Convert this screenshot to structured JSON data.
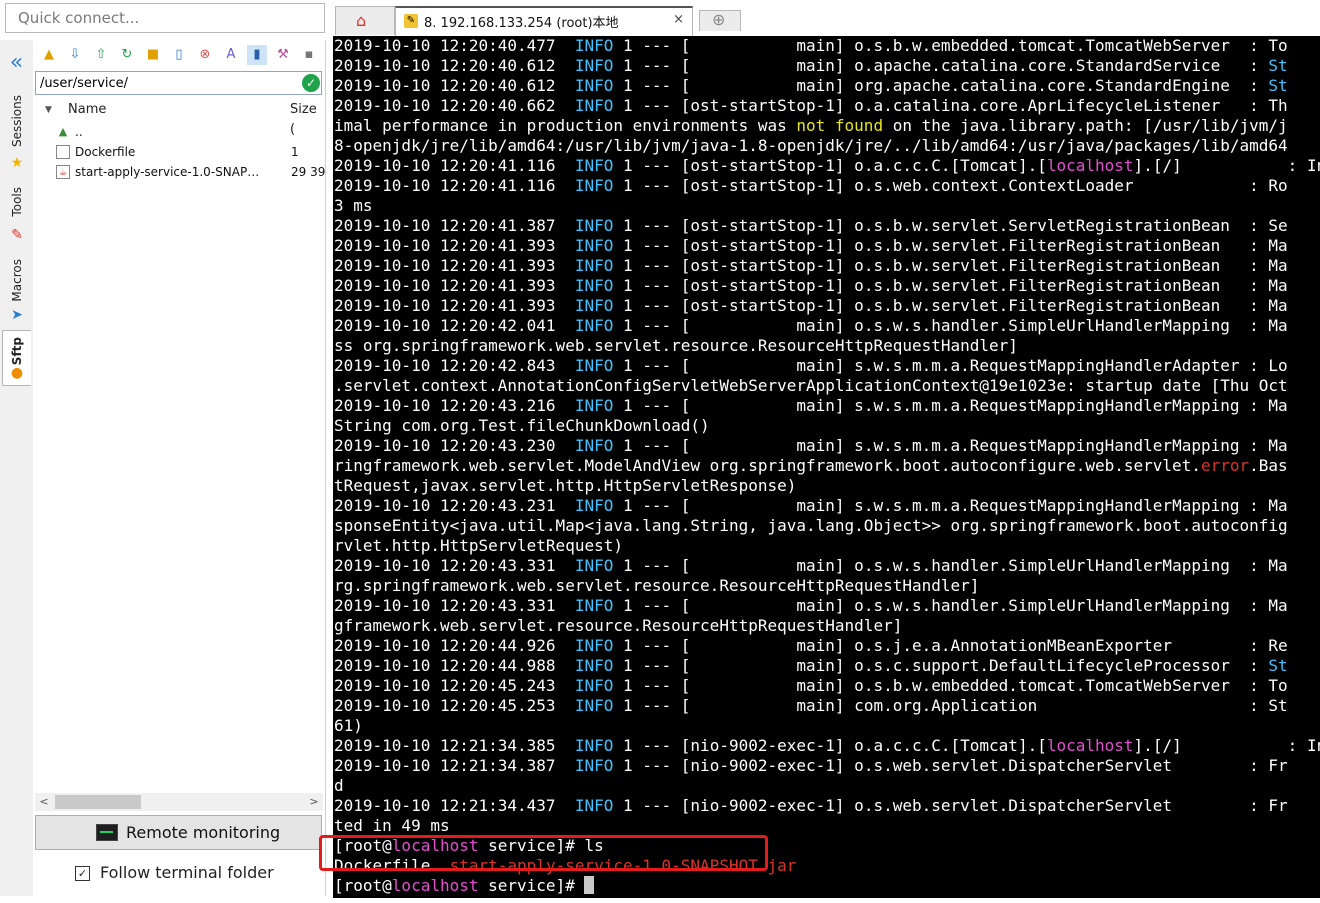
{
  "quick_connect": {
    "placeholder": "Quick connect..."
  },
  "side_tabs": [
    {
      "label": "Sessions",
      "icon": "star-icon"
    },
    {
      "label": "Tools",
      "icon": "tools-icon"
    },
    {
      "label": "Macros",
      "icon": "paper-plane-icon"
    },
    {
      "label": "Sftp",
      "icon": "sftp-icon"
    }
  ],
  "sftp": {
    "path": "/user/service/",
    "columns": {
      "name": "Name",
      "size": "Size ("
    },
    "files": [
      {
        "name": "..",
        "size": "",
        "icon": "folder-up-icon"
      },
      {
        "name": "Dockerfile",
        "size": "1",
        "icon": "file-icon"
      },
      {
        "name": "start-apply-service-1.0-SNAPSHO...",
        "size": "29 39",
        "icon": "jar-file-icon"
      }
    ],
    "remote_monitoring": "Remote monitoring",
    "follow_terminal_folder": "Follow terminal folder",
    "follow_checked": true
  },
  "tabs": {
    "session_number": "8.",
    "session_title": "192.168.133.254  (root)本地",
    "close_glyph": "×"
  },
  "terminal": {
    "lines": [
      [
        [
          "2019-10-10 12:20:40.477  ",
          ""
        ],
        [
          "INFO",
          "info"
        ],
        [
          " 1 --- [           main] o.s.b.w.embedded.tomcat.TomcatWebServer  : To",
          ""
        ]
      ],
      [
        [
          "2019-10-10 12:20:40.612  ",
          ""
        ],
        [
          "INFO",
          "info"
        ],
        [
          " 1 --- [           main] o.apache.catalina.core.StandardService   : ",
          ""
        ],
        [
          "St",
          "info"
        ]
      ],
      [
        [
          "2019-10-10 12:20:40.612  ",
          ""
        ],
        [
          "INFO",
          "info"
        ],
        [
          " 1 --- [           main] org.apache.catalina.core.StandardEngine  : ",
          ""
        ],
        [
          "St",
          "info"
        ]
      ],
      [
        [
          "2019-10-10 12:20:40.662  ",
          ""
        ],
        [
          "INFO",
          "info"
        ],
        [
          " 1 --- [ost-startStop-1] o.a.catalina.core.AprLifecycleListener   : Th",
          ""
        ]
      ],
      [
        [
          "imal performance in production environments was ",
          ""
        ],
        [
          "not found",
          "warn"
        ],
        [
          " on the java.library.path: [/usr/lib/jvm/j",
          ""
        ]
      ],
      [
        [
          "8-openjdk/jre/lib/amd64:/usr/lib/jvm/java-1.8-openjdk/jre/../lib/amd64:/usr/java/packages/lib/amd64",
          ""
        ]
      ],
      [
        [
          "2019-10-10 12:20:41.116  ",
          ""
        ],
        [
          "INFO",
          "info"
        ],
        [
          " 1 --- [ost-startStop-1] o.a.c.c.C.[Tomcat].[",
          ""
        ],
        [
          "localhost",
          "pink"
        ],
        [
          "].[/]           : In",
          ""
        ]
      ],
      [
        [
          "2019-10-10 12:20:41.116  ",
          ""
        ],
        [
          "INFO",
          "info"
        ],
        [
          " 1 --- [ost-startStop-1] o.s.web.context.ContextLoader            : Ro",
          ""
        ]
      ],
      [
        [
          "3 ms",
          ""
        ]
      ],
      [
        [
          "2019-10-10 12:20:41.387  ",
          ""
        ],
        [
          "INFO",
          "info"
        ],
        [
          " 1 --- [ost-startStop-1] o.s.b.w.servlet.ServletRegistrationBean  : Se",
          ""
        ]
      ],
      [
        [
          "2019-10-10 12:20:41.393  ",
          ""
        ],
        [
          "INFO",
          "info"
        ],
        [
          " 1 --- [ost-startStop-1] o.s.b.w.servlet.FilterRegistrationBean   : Ma",
          ""
        ]
      ],
      [
        [
          "2019-10-10 12:20:41.393  ",
          ""
        ],
        [
          "INFO",
          "info"
        ],
        [
          " 1 --- [ost-startStop-1] o.s.b.w.servlet.FilterRegistrationBean   : Ma",
          ""
        ]
      ],
      [
        [
          "2019-10-10 12:20:41.393  ",
          ""
        ],
        [
          "INFO",
          "info"
        ],
        [
          " 1 --- [ost-startStop-1] o.s.b.w.servlet.FilterRegistrationBean   : Ma",
          ""
        ]
      ],
      [
        [
          "2019-10-10 12:20:41.393  ",
          ""
        ],
        [
          "INFO",
          "info"
        ],
        [
          " 1 --- [ost-startStop-1] o.s.b.w.servlet.FilterRegistrationBean   : Ma",
          ""
        ]
      ],
      [
        [
          "2019-10-10 12:20:42.041  ",
          ""
        ],
        [
          "INFO",
          "info"
        ],
        [
          " 1 --- [           main] o.s.w.s.handler.SimpleUrlHandlerMapping  : Ma",
          ""
        ]
      ],
      [
        [
          "ss org.springframework.web.servlet.resource.ResourceHttpRequestHandler]",
          ""
        ]
      ],
      [
        [
          "2019-10-10 12:20:42.843  ",
          ""
        ],
        [
          "INFO",
          "info"
        ],
        [
          " 1 --- [           main] s.w.s.m.m.a.RequestMappingHandlerAdapter : Lo",
          ""
        ]
      ],
      [
        [
          ".servlet.context.AnnotationConfigServletWebServerApplicationContext@19e1023e: startup date [Thu Oct",
          ""
        ]
      ],
      [
        [
          "2019-10-10 12:20:43.216  ",
          ""
        ],
        [
          "INFO",
          "info"
        ],
        [
          " 1 --- [           main] s.w.s.m.m.a.RequestMappingHandlerMapping : Ma",
          ""
        ]
      ],
      [
        [
          "String com.org.Test.fileChunkDownload()",
          ""
        ]
      ],
      [
        [
          "2019-10-10 12:20:43.230  ",
          ""
        ],
        [
          "INFO",
          "info"
        ],
        [
          " 1 --- [           main] s.w.s.m.m.a.RequestMappingHandlerMapping : Ma",
          ""
        ]
      ],
      [
        [
          "ringframework.web.servlet.ModelAndView org.springframework.boot.autoconfigure.web.servlet.",
          ""
        ],
        [
          "error",
          "red"
        ],
        [
          ".Bas",
          ""
        ]
      ],
      [
        [
          "tRequest,javax.servlet.http.HttpServletResponse)",
          ""
        ]
      ],
      [
        [
          "2019-10-10 12:20:43.231  ",
          ""
        ],
        [
          "INFO",
          "info"
        ],
        [
          " 1 --- [           main] s.w.s.m.m.a.RequestMappingHandlerMapping : Ma",
          ""
        ]
      ],
      [
        [
          "sponseEntity<java.util.Map<java.lang.String, java.lang.Object>> org.springframework.boot.autoconfig",
          ""
        ]
      ],
      [
        [
          "rvlet.http.HttpServletRequest)",
          ""
        ]
      ],
      [
        [
          "2019-10-10 12:20:43.331  ",
          ""
        ],
        [
          "INFO",
          "info"
        ],
        [
          " 1 --- [           main] o.s.w.s.handler.SimpleUrlHandlerMapping  : Ma",
          ""
        ]
      ],
      [
        [
          "rg.springframework.web.servlet.resource.ResourceHttpRequestHandler]",
          ""
        ]
      ],
      [
        [
          "2019-10-10 12:20:43.331  ",
          ""
        ],
        [
          "INFO",
          "info"
        ],
        [
          " 1 --- [           main] o.s.w.s.handler.SimpleUrlHandlerMapping  : Ma",
          ""
        ]
      ],
      [
        [
          "gframework.web.servlet.resource.ResourceHttpRequestHandler]",
          ""
        ]
      ],
      [
        [
          "2019-10-10 12:20:44.926  ",
          ""
        ],
        [
          "INFO",
          "info"
        ],
        [
          " 1 --- [           main] o.s.j.e.a.AnnotationMBeanExporter        : Re",
          ""
        ]
      ],
      [
        [
          "2019-10-10 12:20:44.988  ",
          ""
        ],
        [
          "INFO",
          "info"
        ],
        [
          " 1 --- [           main] o.s.c.support.DefaultLifecycleProcessor  : ",
          ""
        ],
        [
          "St",
          "info"
        ]
      ],
      [
        [
          "2019-10-10 12:20:45.243  ",
          ""
        ],
        [
          "INFO",
          "info"
        ],
        [
          " 1 --- [           main] o.s.b.w.embedded.tomcat.TomcatWebServer  : To",
          ""
        ]
      ],
      [
        [
          "2019-10-10 12:20:45.253  ",
          ""
        ],
        [
          "INFO",
          "info"
        ],
        [
          " 1 --- [           main] com.org.Application                      : St",
          ""
        ]
      ],
      [
        [
          "61)",
          ""
        ]
      ],
      [
        [
          "2019-10-10 12:21:34.385  ",
          ""
        ],
        [
          "INFO",
          "info"
        ],
        [
          " 1 --- [nio-9002-exec-1] o.a.c.c.C.[Tomcat].[",
          ""
        ],
        [
          "localhost",
          "pink"
        ],
        [
          "].[/]           : In",
          ""
        ]
      ],
      [
        [
          "2019-10-10 12:21:34.387  ",
          ""
        ],
        [
          "INFO",
          "info"
        ],
        [
          " 1 --- [nio-9002-exec-1] o.s.web.servlet.DispatcherServlet        : Fr",
          ""
        ]
      ],
      [
        [
          "d",
          ""
        ]
      ],
      [
        [
          "2019-10-10 12:21:34.437  ",
          ""
        ],
        [
          "INFO",
          "info"
        ],
        [
          " 1 --- [nio-9002-exec-1] o.s.web.servlet.DispatcherServlet        : Fr",
          ""
        ]
      ],
      [
        [
          "ted in 49 ms",
          ""
        ]
      ],
      [
        [
          "[root@",
          ""
        ],
        [
          "localhost",
          "pink"
        ],
        [
          " service]# ls",
          ""
        ]
      ],
      [
        [
          "Dockerfile  ",
          ""
        ],
        [
          "start-apply-service-1.0-SNAPSHOT.jar",
          "red"
        ]
      ],
      [
        [
          "[root@",
          ""
        ],
        [
          "localhost",
          "pink"
        ],
        [
          " service]# ",
          ""
        ]
      ]
    ]
  },
  "colors": {
    "info": "#3fc3ff",
    "warn": "#e6e61e",
    "hostname": "#e34fd0",
    "error": "#d9342b",
    "highlight_box": "#e31b1b"
  }
}
